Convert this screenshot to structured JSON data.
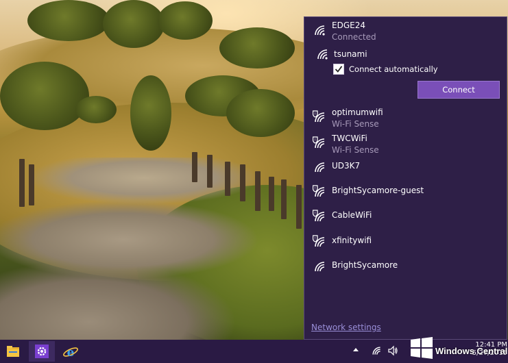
{
  "networks": [
    {
      "name": "EDGE24",
      "status": "Connected",
      "secured": false
    },
    {
      "name": "tsunami",
      "status": "",
      "secured": false
    },
    {
      "name": "optimumwifi",
      "status": "Wi-Fi Sense",
      "secured": true
    },
    {
      "name": "TWCWiFi",
      "status": "Wi-Fi Sense",
      "secured": true
    },
    {
      "name": "UD3K7",
      "status": "",
      "secured": false
    },
    {
      "name": "BrightSycamore-guest",
      "status": "",
      "secured": true
    },
    {
      "name": "CableWiFi",
      "status": "",
      "secured": true
    },
    {
      "name": "xfinitywifi",
      "status": "",
      "secured": true
    },
    {
      "name": "BrightSycamore",
      "status": "",
      "secured": false
    }
  ],
  "selected": {
    "connect_automatically_label": "Connect automatically",
    "connect_automatically_checked": true,
    "connect_label": "Connect"
  },
  "footer": {
    "network_settings_label": "Network settings"
  },
  "taskbar": {
    "apps": [
      "file-explorer-icon",
      "settings-icon",
      "internet-explorer-icon"
    ],
    "clock_time": "12:41 PM",
    "clock_date": "5/27/2015"
  },
  "watermark": {
    "text": "Windows Central"
  },
  "colors": {
    "flyout_bg": "#2e1f47",
    "accent": "#7a4fb8",
    "link": "#9a8fd8",
    "subtext": "#a79ab9",
    "taskbar_bg": "#2a1a44"
  }
}
